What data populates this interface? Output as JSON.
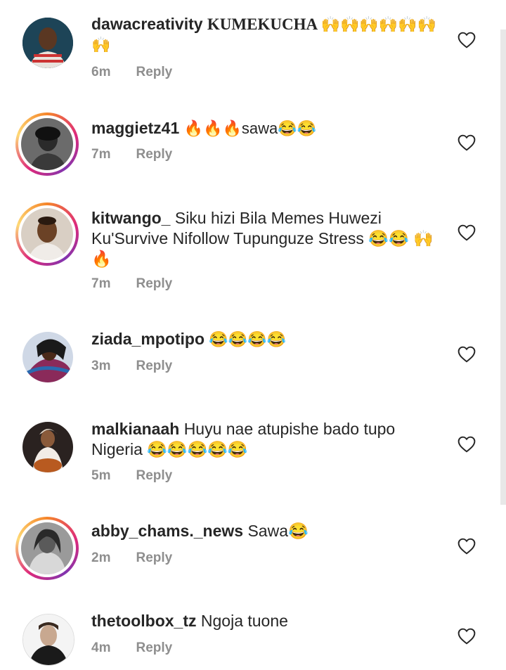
{
  "comments": [
    {
      "username": "dawacreativity",
      "text": "KUMEKUCHA",
      "emoji_text": "🙌🙌🙌🙌🙌🙌🙌",
      "time": "6m",
      "reply": "Reply",
      "avatar_icon": "man-avatar-photo",
      "story_ring": false
    },
    {
      "username": "maggietz41",
      "text": "🔥🔥🔥sawa😂😂",
      "time": "7m",
      "reply": "Reply",
      "avatar_icon": "woman-avatar-photo",
      "story_ring": true
    },
    {
      "username": "kitwango_",
      "text": "Siku hizi Bila Memes Huwezi Ku'Survive Nifollow Tupunguze Stress 😂😂 🙌🔥",
      "time": "7m",
      "reply": "Reply",
      "avatar_icon": "man-avatar-photo",
      "story_ring": true
    },
    {
      "username": "ziada_mpotipo",
      "text": "😂😂😂😂",
      "time": "3m",
      "reply": "Reply",
      "avatar_icon": "woman-avatar-photo",
      "story_ring": false
    },
    {
      "username": "malkianaah",
      "text": "Huyu nae atupishe bado tupo Nigeria 😂😂😂😂😂",
      "time": "5m",
      "reply": "Reply",
      "avatar_icon": "woman-avatar-photo",
      "story_ring": false
    },
    {
      "username": "abby_chams._news",
      "text": "Sawa😂",
      "time": "2m",
      "reply": "Reply",
      "avatar_icon": "woman-avatar-photo",
      "story_ring": true
    },
    {
      "username": "thetoolbox_tz",
      "text": "Ngoja tuone",
      "time": "4m",
      "reply": "Reply",
      "avatar_icon": "man-avatar-photo",
      "story_ring": false
    }
  ],
  "colors": {
    "text": "#262626",
    "meta": "#8e8e8e",
    "ring_start": "#f58529",
    "ring_mid": "#dd2a7b"
  }
}
